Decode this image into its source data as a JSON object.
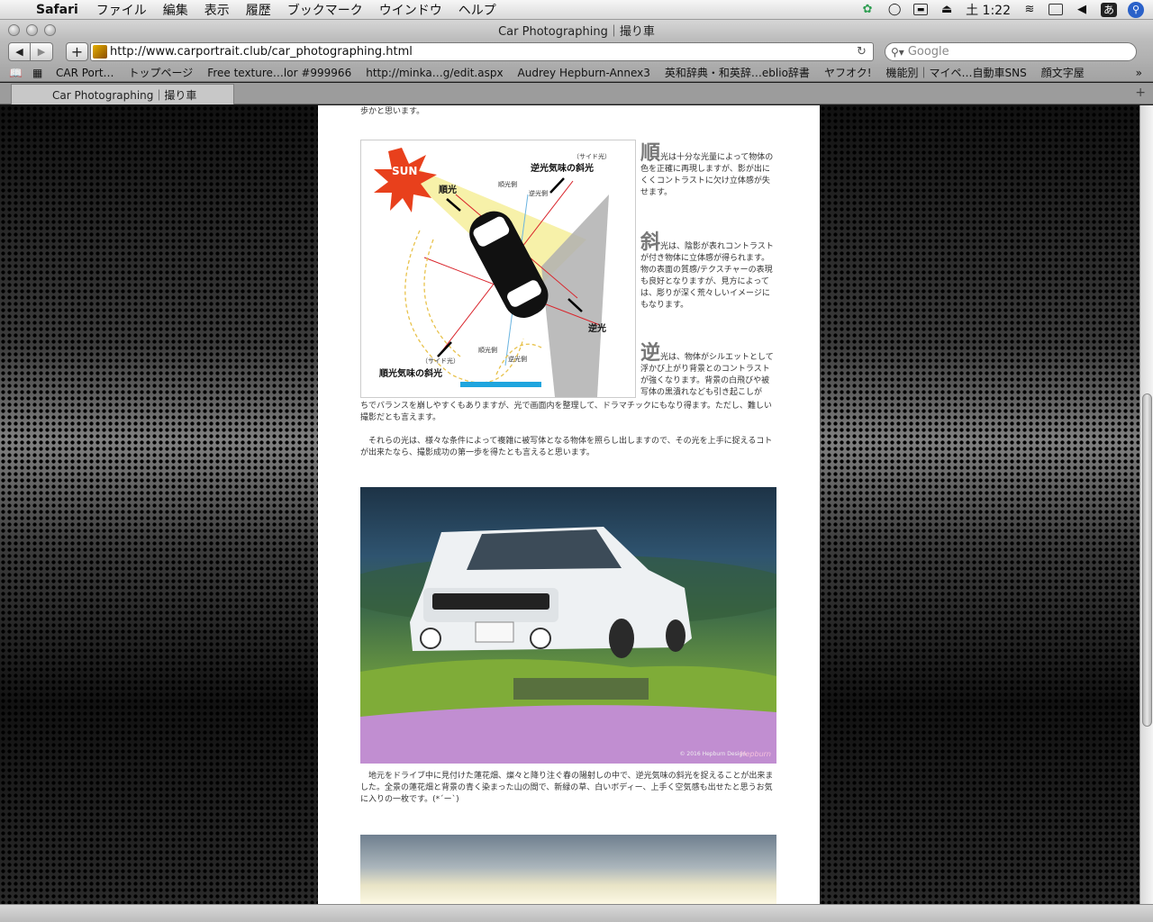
{
  "menubar": {
    "app": "Safari",
    "items": [
      "ファイル",
      "編集",
      "表示",
      "履歴",
      "ブックマーク",
      "ウインドウ",
      "ヘルプ"
    ],
    "clock": "土 1:22",
    "input_method": "あ"
  },
  "window": {
    "title": "Car Photographing｜撮り車"
  },
  "toolbar": {
    "url": "http://www.carportrait.club/car_photographing.html",
    "search_placeholder": "Google"
  },
  "bookmarks": [
    "CAR Port…",
    "トップページ",
    "Free texture…lor #999966",
    "http://minka…g/edit.aspx",
    "Audrey Hepburn-Annex3",
    "英和辞典・和英辞…eblio辞書",
    "ヤフオク!",
    "機能別｜マイペ…自動車SNS",
    "顔文字屋"
  ],
  "tab": {
    "label": "Car Photographing｜撮り車"
  },
  "content": {
    "first_line": "歩かと思います。",
    "diagram": {
      "sun": "SUN",
      "junko": "順光",
      "gyakko_shako_small": "（サイド光）",
      "gyakko_shako": "逆光気味の斜光",
      "junko_side_small": "順光側",
      "gyakko_side_small": "逆光側",
      "gyakko": "逆光",
      "junko_shako_small": "（サイド光）",
      "junko_shako": "順光気味の斜光",
      "junko_side_small_2": "順光側",
      "gyakko_side_small_2": "逆光側"
    },
    "side1_big": "順",
    "side1_text": "光は十分な光量によって物体の色を正確に再現しますが、影が出にくくコントラストに欠け立体感が失せます。",
    "side2_big": "斜",
    "side2_text": "光は、陰影が表れコントラストが付き物体に立体感が得られます。物の表面の質感/テクスチャーの表現も良好となりますが、見方によっては、彫りが深く荒々しいイメージにもなります。",
    "side3_big": "逆",
    "side3_text": "光は、物体がシルエットとして浮かび上がり背景とのコントラストが強くなります。背景の白飛びや被写体の黒潰れなども引き起こしが",
    "para1_tail": "ちでバランスを崩しやすくもありますが、光で画面内を整理して、ドラマチックにもなり得ます。ただし、難しい撮影だとも言えます。",
    "para2": "　それらの光は、様々な条件によって複雑に被写体となる物体を照らし出しますので、その光を上手に捉えるコトが出来たなら、撮影成功の第一歩を得たとも言えると思います。",
    "photo1_copyright": "© 2016 Hepburn Design",
    "photo1_signature": "Hepburn",
    "caption1": "　地元をドライブ中に見付けた蓮花畑、燦々と降り注ぐ春の陽射しの中で、逆光気味の斜光を捉えることが出来ました。全景の蓮花畑と背景の青く染まった山の間で、新緑の草、白いボディー、上手く空気感も出せたと思うお気に入りの一枚です。(*´ー`)"
  },
  "colors": {
    "sun": "#e8401c",
    "light_beam": "#f6f0a0",
    "shadow": "#a8a8a8",
    "scroll_thumb": "#c4c4c4"
  }
}
